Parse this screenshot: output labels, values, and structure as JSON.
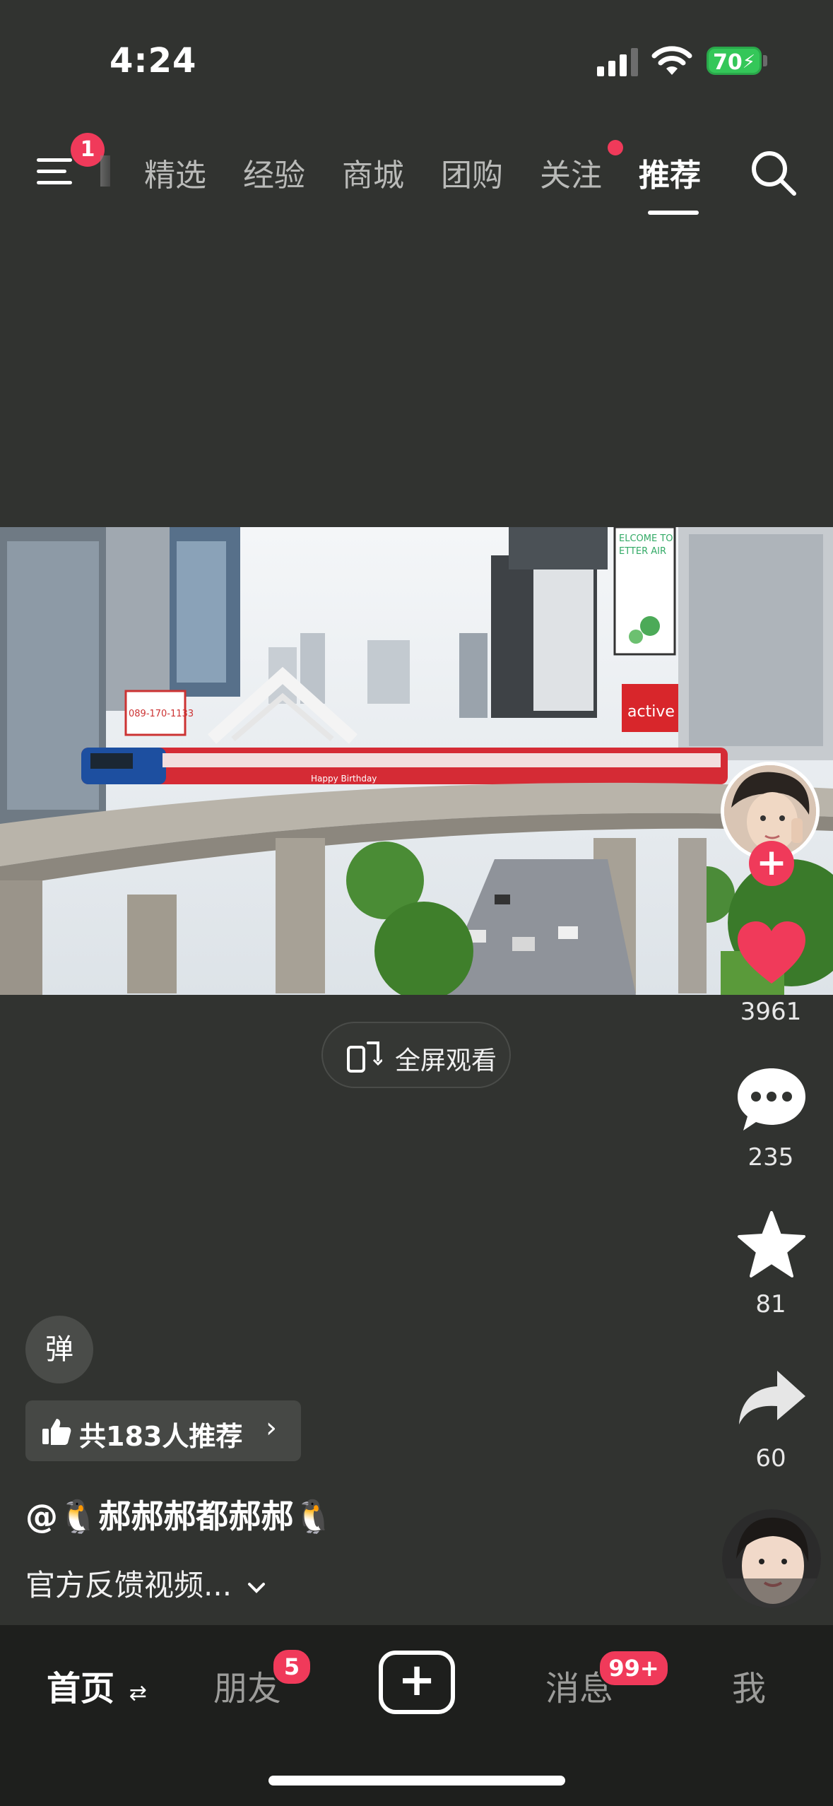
{
  "status_bar": {
    "time": "4:24",
    "battery_level": "70"
  },
  "top_nav": {
    "menu_badge": "1",
    "tabs": [
      {
        "label": "精选"
      },
      {
        "label": "经验"
      },
      {
        "label": "商城"
      },
      {
        "label": "团购"
      },
      {
        "label": "关注"
      },
      {
        "label": "推荐"
      }
    ],
    "active_tab": "推荐"
  },
  "video": {
    "fullscreen_label": "全屏观看",
    "billboard_phone": "089-170-1133",
    "billboard_top": "ELCOME TO\nETTER AIR",
    "billboard_active": "active",
    "train_text": "Happy Birthday"
  },
  "actions": {
    "likes": "3961",
    "comments": "235",
    "favorites": "81",
    "shares": "60"
  },
  "caption": {
    "danmu_label": "弹",
    "recommend_text": "共183人推荐",
    "author": "@🐧郝郝郝都郝郝🐧",
    "description": "官方反馈视频..."
  },
  "tab_bar": {
    "home": "首页",
    "friends": "朋友",
    "friends_badge": "5",
    "messages": "消息",
    "messages_badge": "99+",
    "me": "我"
  },
  "colors": {
    "accent": "#f03a5a",
    "background": "#313330",
    "tabbar": "#1e1f1d"
  }
}
